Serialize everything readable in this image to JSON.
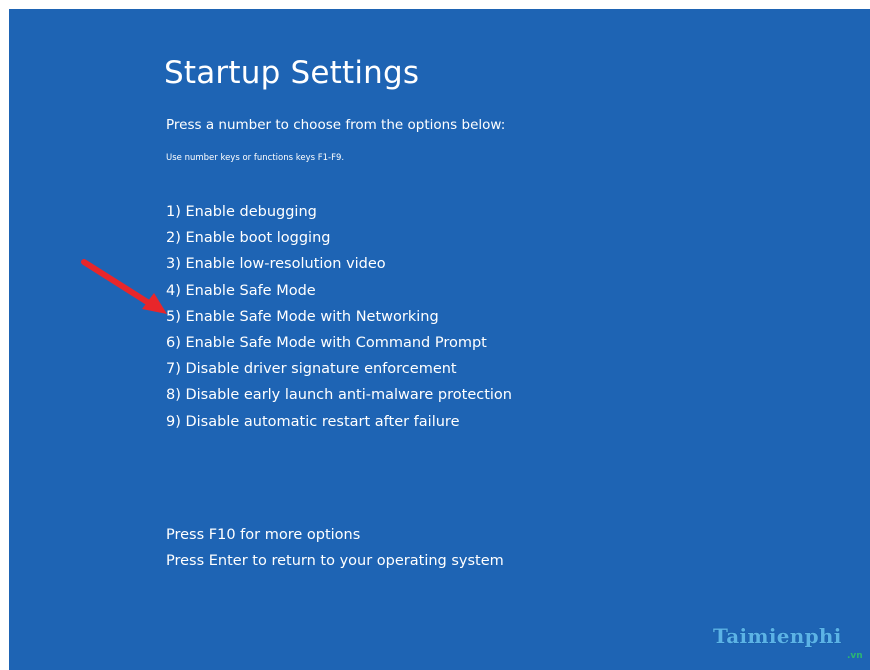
{
  "title": "Startup Settings",
  "subtitle": "Press a number to choose from the options below:",
  "hint": "Use number keys or functions keys F1-F9.",
  "options": [
    "1) Enable debugging",
    "2) Enable boot logging",
    "3) Enable low-resolution video",
    "4) Enable Safe Mode",
    "5) Enable Safe Mode with Networking",
    "6) Enable Safe Mode with Command Prompt",
    "7) Disable driver signature enforcement",
    "8) Disable early launch anti-malware protection",
    "9) Disable automatic restart after failure"
  ],
  "footer": {
    "more_options": "Press F10 for more options",
    "return": "Press Enter to return to your operating system"
  },
  "watermark": {
    "brand": "Taimienphi",
    "tld": ".vn"
  },
  "colors": {
    "background": "#1e64b4",
    "text": "#ffffff",
    "arrow": "#e8262a",
    "watermark": "#5cb3e6"
  },
  "annotation": {
    "arrow_points_to_option_index": 4
  }
}
